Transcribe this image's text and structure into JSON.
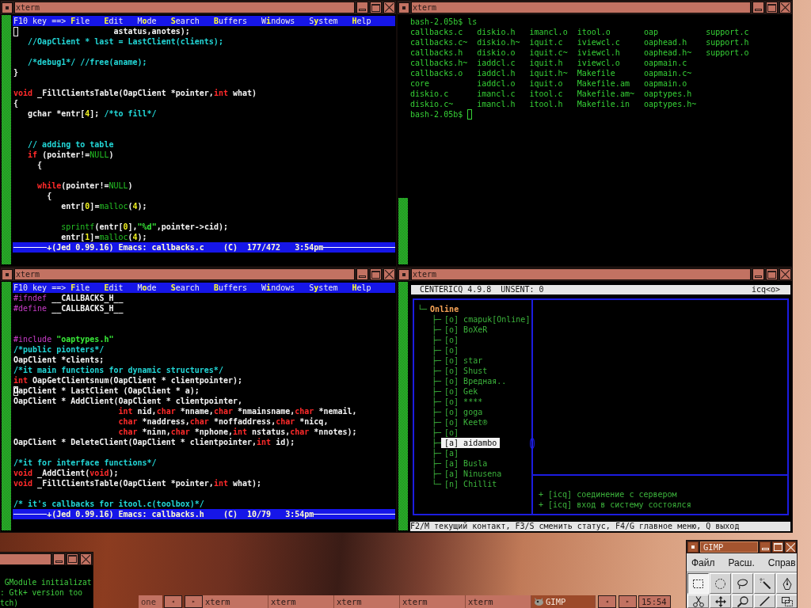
{
  "editor_top": {
    "title": "xterm",
    "menu": {
      "prompt": "F10 key ==>",
      "items": [
        "**F**ile",
        "**E**dit",
        "M**o**de",
        "**S**earch",
        "**B**uffers",
        "W**i**ndows",
        "S**y**stem",
        "**H**elp"
      ]
    },
    "lines": [
      {
        "kind": "code",
        "cursor": true,
        "parts": [
          {
            "kind": "plain",
            "text": "                     astatus,anotes);"
          }
        ]
      },
      {
        "kind": "code",
        "parts": [
          {
            "kind": "comment",
            "text": "   //OapClient * last = LastClient(clients);"
          }
        ]
      },
      {
        "kind": "blank"
      },
      {
        "kind": "code",
        "parts": [
          {
            "kind": "comment",
            "text": "   /*debug1*/ //free(aname);"
          }
        ]
      },
      {
        "kind": "code",
        "parts": [
          {
            "kind": "plain",
            "text": "}"
          }
        ]
      },
      {
        "kind": "blank"
      },
      {
        "kind": "code",
        "parts": [
          {
            "kind": "keyword",
            "text": "void"
          },
          {
            "kind": "plain",
            "text": " _FillClientsTable(OapClient *pointer,"
          },
          {
            "kind": "keyword",
            "text": "int"
          },
          {
            "kind": "plain",
            "text": " what)"
          }
        ]
      },
      {
        "kind": "code",
        "parts": [
          {
            "kind": "plain",
            "text": "{"
          }
        ]
      },
      {
        "kind": "code",
        "parts": [
          {
            "kind": "plain",
            "text": "   gchar *entr["
          },
          {
            "kind": "number",
            "text": "4"
          },
          {
            "kind": "plain",
            "text": "]; "
          },
          {
            "kind": "comment",
            "text": "/*to fill*/"
          }
        ]
      },
      {
        "kind": "blank"
      },
      {
        "kind": "blank"
      },
      {
        "kind": "code",
        "parts": [
          {
            "kind": "comment",
            "text": "   // adding to table"
          }
        ]
      },
      {
        "kind": "code",
        "parts": [
          {
            "kind": "keyword",
            "text": "   if"
          },
          {
            "kind": "plain",
            "text": " (pointer!="
          },
          {
            "kind": "builtin",
            "text": "NULL"
          },
          {
            "kind": "plain",
            "text": ")"
          }
        ]
      },
      {
        "kind": "code",
        "parts": [
          {
            "kind": "plain",
            "text": "     {"
          }
        ]
      },
      {
        "kind": "blank"
      },
      {
        "kind": "code",
        "parts": [
          {
            "kind": "keyword",
            "text": "     while"
          },
          {
            "kind": "plain",
            "text": "(pointer!="
          },
          {
            "kind": "builtin",
            "text": "NULL"
          },
          {
            "kind": "plain",
            "text": ")"
          }
        ]
      },
      {
        "kind": "code",
        "parts": [
          {
            "kind": "plain",
            "text": "       {"
          }
        ]
      },
      {
        "kind": "code",
        "parts": [
          {
            "kind": "plain",
            "text": "          entr["
          },
          {
            "kind": "number",
            "text": "0"
          },
          {
            "kind": "plain",
            "text": "]="
          },
          {
            "kind": "builtin",
            "text": "malloc"
          },
          {
            "kind": "plain",
            "text": "("
          },
          {
            "kind": "number",
            "text": "4"
          },
          {
            "kind": "plain",
            "text": ");"
          }
        ]
      },
      {
        "kind": "blank"
      },
      {
        "kind": "code",
        "parts": [
          {
            "kind": "builtin",
            "text": "          sprintf"
          },
          {
            "kind": "plain",
            "text": "(entr["
          },
          {
            "kind": "number",
            "text": "0"
          },
          {
            "kind": "plain",
            "text": "],"
          },
          {
            "kind": "string",
            "text": "\"%d\""
          },
          {
            "kind": "plain",
            "text": ",pointer->cid);"
          }
        ]
      },
      {
        "kind": "code",
        "parts": [
          {
            "kind": "plain",
            "text": "          entr["
          },
          {
            "kind": "number",
            "text": "1"
          },
          {
            "kind": "plain",
            "text": "]="
          },
          {
            "kind": "builtin",
            "text": "malloc"
          },
          {
            "kind": "plain",
            "text": "("
          },
          {
            "kind": "number",
            "text": "4"
          },
          {
            "kind": "plain",
            "text": ");"
          }
        ]
      }
    ],
    "status_line": {
      "buffer": "+(Jed 0.99.16) Emacs: callbacks.c",
      "mode": "(C)",
      "position": "177/472",
      "time": "3:54pm"
    }
  },
  "terminal": {
    "title": "xterm",
    "command": "bash-2.05b$ ls",
    "listing": [
      [
        "callbacks.c",
        "diskio.h",
        "imancl.o",
        "itool.o",
        "oap",
        "support.c"
      ],
      [
        "callbacks.c~",
        "diskio.h~",
        "iquit.c",
        "iviewcl.c",
        "oaphead.h",
        "support.h"
      ],
      [
        "callbacks.h",
        "diskio.o",
        "iquit.c~",
        "iviewcl.h",
        "oaphead.h~",
        "support.o"
      ],
      [
        "callbacks.h~",
        "iaddcl.c",
        "iquit.h",
        "iviewcl.o",
        "oapmain.c"
      ],
      [
        "callbacks.o",
        "iaddcl.h",
        "iquit.h~",
        "Makefile",
        "oapmain.c~"
      ],
      [
        "core",
        "iaddcl.o",
        "iquit.o",
        "Makefile.am",
        "oapmain.o"
      ],
      [
        "diskio.c",
        "imancl.c",
        "itool.c",
        "Makefile.am~",
        "oaptypes.h"
      ],
      [
        "diskio.c~",
        "imancl.h",
        "itool.h",
        "Makefile.in",
        "oaptypes.h~"
      ]
    ],
    "prompt": "bash-2.05b$",
    "cursor": true
  },
  "editor_bottom": {
    "title": "xterm",
    "menu": {
      "prompt": "F10 key ==>",
      "items": [
        "**F**ile",
        "**E**dit",
        "M**o**de",
        "**S**earch",
        "**B**uffers",
        "W**i**ndows",
        "S**y**stem",
        "**H**elp"
      ]
    },
    "lines": [
      {
        "kind": "code",
        "parts": [
          {
            "kind": "preproc",
            "text": "#ifndef"
          },
          {
            "kind": "plain",
            "text": " __CALLBACKS_H__"
          }
        ]
      },
      {
        "kind": "code",
        "parts": [
          {
            "kind": "preproc",
            "text": "#define"
          },
          {
            "kind": "plain",
            "text": " __CALLBACKS_H__"
          }
        ]
      },
      {
        "kind": "blank"
      },
      {
        "kind": "blank"
      },
      {
        "kind": "code",
        "parts": [
          {
            "kind": "preproc",
            "text": "#include"
          },
          {
            "kind": "string",
            "text": " \"oaptypes.h\""
          }
        ]
      },
      {
        "kind": "code",
        "parts": [
          {
            "kind": "comment",
            "text": "/*public pionters*/"
          }
        ]
      },
      {
        "kind": "code",
        "parts": [
          {
            "kind": "plain",
            "text": "OapClient *clients;"
          }
        ]
      },
      {
        "kind": "code",
        "parts": [
          {
            "kind": "comment",
            "text": "/*it main functions for dynamic structures*/"
          }
        ]
      },
      {
        "kind": "code",
        "parts": [
          {
            "kind": "keyword",
            "text": "int"
          },
          {
            "kind": "plain",
            "text": " OapGetClientsnum(OapClient * clientpointer);"
          }
        ]
      },
      {
        "kind": "code",
        "cursor": true,
        "parts": [
          {
            "kind": "plain",
            "text": "OapClient * LastClient (OapClient * a);"
          }
        ]
      },
      {
        "kind": "code",
        "parts": [
          {
            "kind": "plain",
            "text": "OapClient * AddClient(OapClient * clientpointer,"
          }
        ]
      },
      {
        "kind": "code",
        "parts": [
          {
            "kind": "keyword",
            "text": "                      int"
          },
          {
            "kind": "plain",
            "text": " nid,"
          },
          {
            "kind": "keyword",
            "text": "char"
          },
          {
            "kind": "plain",
            "text": " *nname,"
          },
          {
            "kind": "keyword",
            "text": "char"
          },
          {
            "kind": "plain",
            "text": " *nmainsname,"
          },
          {
            "kind": "keyword",
            "text": "char"
          },
          {
            "kind": "plain",
            "text": " *nemail,"
          }
        ]
      },
      {
        "kind": "code",
        "parts": [
          {
            "kind": "keyword",
            "text": "                      char"
          },
          {
            "kind": "plain",
            "text": " *naddress,"
          },
          {
            "kind": "keyword",
            "text": "char"
          },
          {
            "kind": "plain",
            "text": " *noffaddress,"
          },
          {
            "kind": "keyword",
            "text": "char"
          },
          {
            "kind": "plain",
            "text": " *nicq,"
          }
        ]
      },
      {
        "kind": "code",
        "parts": [
          {
            "kind": "keyword",
            "text": "                      char"
          },
          {
            "kind": "plain",
            "text": " *ninn,"
          },
          {
            "kind": "keyword",
            "text": "char"
          },
          {
            "kind": "plain",
            "text": " *nphone,"
          },
          {
            "kind": "keyword",
            "text": "int"
          },
          {
            "kind": "plain",
            "text": " nstatus,"
          },
          {
            "kind": "keyword",
            "text": "char"
          },
          {
            "kind": "plain",
            "text": " *nnotes);"
          }
        ]
      },
      {
        "kind": "code",
        "parts": [
          {
            "kind": "plain",
            "text": "OapClient * DeleteClient(OapClient * clientpointer,"
          },
          {
            "kind": "keyword",
            "text": "int"
          },
          {
            "kind": "plain",
            "text": " id);"
          }
        ]
      },
      {
        "kind": "blank"
      },
      {
        "kind": "code",
        "parts": [
          {
            "kind": "comment",
            "text": "/*it for interface functions*/"
          }
        ]
      },
      {
        "kind": "code",
        "parts": [
          {
            "kind": "keyword",
            "text": "void"
          },
          {
            "kind": "plain",
            "text": " _AddClient("
          },
          {
            "kind": "keyword",
            "text": "void"
          },
          {
            "kind": "plain",
            "text": ");"
          }
        ]
      },
      {
        "kind": "code",
        "parts": [
          {
            "kind": "keyword",
            "text": "void"
          },
          {
            "kind": "plain",
            "text": " _FillClientsTable(OapClient *pointer,"
          },
          {
            "kind": "keyword",
            "text": "int"
          },
          {
            "kind": "plain",
            "text": " what);"
          }
        ]
      },
      {
        "kind": "blank"
      },
      {
        "kind": "code",
        "parts": [
          {
            "kind": "comment",
            "text": "/* it's callbacks for itool.c(toolbox)*/"
          }
        ]
      }
    ],
    "status_line": {
      "buffer": "+(Jed 0.99.16) Emacs: callbacks.h",
      "mode": "(C)",
      "position": "10/79",
      "time": "3:54pm"
    }
  },
  "centericq": {
    "title": "xterm",
    "header": {
      "app": "CENTERICQ 4.9.8",
      "unsent": "UNSENT: 0",
      "protocol": "icq<o>"
    },
    "contacts": {
      "branch": "└─",
      "label": "Online",
      "children": [
        {
          "branch": "├─",
          "status": "[o]",
          "name": "cmapuk[Online]",
          "selected": false
        },
        {
          "branch": "├─",
          "status": "[o]",
          "name": "BoXeR",
          "selected": false
        },
        {
          "branch": "├─",
          "status": "[o]",
          "selected": false
        },
        {
          "branch": "├─",
          "status": "[o]",
          "selected": false
        },
        {
          "branch": "├─",
          "status": "[o]",
          "name": "star",
          "selected": false
        },
        {
          "branch": "├─",
          "status": "[o]",
          "name": "Shust",
          "selected": false
        },
        {
          "branch": "├─",
          "status": "[o]",
          "name": "Вредная..",
          "selected": false
        },
        {
          "branch": "├─",
          "status": "[o]",
          "name": "Gek",
          "selected": false
        },
        {
          "branch": "├─",
          "status": "[o]",
          "name": "****",
          "selected": false
        },
        {
          "branch": "├─",
          "status": "[o]",
          "name": "goga",
          "selected": false
        },
        {
          "branch": "├─",
          "status": "[o]",
          "name": "Keet®",
          "selected": false
        },
        {
          "branch": "├─",
          "status": "[o]",
          "selected": false
        },
        {
          "branch": "├─",
          "status": "[a]",
          "name": "aidambo",
          "selected": true
        },
        {
          "branch": "├─",
          "status": "[a]",
          "selected": false
        },
        {
          "branch": "├─",
          "status": "[a]",
          "name": "Busla",
          "selected": false
        },
        {
          "branch": "├─",
          "status": "[a]",
          "name": "Ninusena",
          "selected": false
        },
        {
          "branch": "└─",
          "status": "[n]",
          "name": "Chillit",
          "selected": false
        }
      ]
    },
    "log": [
      "+ [icq] соединение с сервером",
      "+ [icq] вход в систему состоялся"
    ],
    "hints": "F2/M текущий контакт, F3/S сменить статус, F4/G главное меню, Q выход"
  },
  "console": {
    "lines": [
      " GModule initializat",
      ": Gtk+ version too",
      "tch)"
    ]
  },
  "taskbar": {
    "desk": "one",
    "pager_arrows": [
      "◂",
      "▸"
    ],
    "tasks": [
      {
        "label": "xterm",
        "kind": "plain",
        "selected": false
      },
      {
        "label": "xterm",
        "kind": "plain",
        "selected": false
      },
      {
        "label": "xterm",
        "kind": "plain",
        "selected": false
      },
      {
        "label": "xterm",
        "kind": "plain",
        "selected": false
      },
      {
        "label": "xterm",
        "kind": "plain",
        "selected": false
      },
      {
        "label": "GIMP",
        "kind": "icon",
        "selected": true
      }
    ],
    "task_arrows": [
      "◂",
      "▸"
    ],
    "clock": "15:54"
  },
  "gimp": {
    "title": "GIMP",
    "menu": [
      "Файл",
      "Расш.",
      "Справ"
    ],
    "tools": [
      {
        "kind": "rect",
        "selected": true
      },
      {
        "kind": "ellipse",
        "selected": false
      },
      {
        "kind": "lasso",
        "selected": false
      },
      {
        "kind": "wand",
        "selected": false
      },
      {
        "kind": "pen",
        "selected": false
      },
      {
        "kind": "scissors",
        "selected": false
      },
      {
        "kind": "move",
        "selected": false
      },
      {
        "kind": "magnifier",
        "selected": false
      },
      {
        "kind": "line",
        "selected": false
      },
      {
        "kind": "frame",
        "selected": false
      }
    ]
  }
}
